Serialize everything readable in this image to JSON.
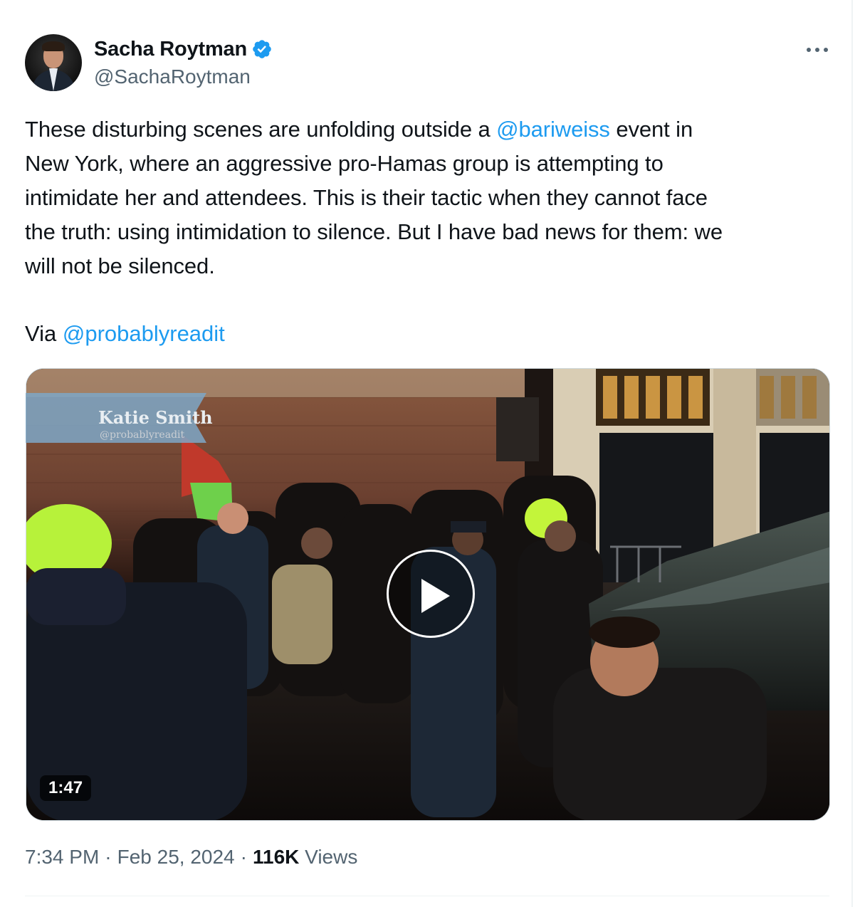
{
  "author": {
    "display_name": "Sacha Roytman",
    "handle": "@SachaRoytman",
    "verified": true,
    "verified_color": "#1d9bf0"
  },
  "menu": {
    "icon": "more-horizontal-icon",
    "glyph": "···"
  },
  "tweet": {
    "lines": [
      {
        "before": "These disturbing scenes are unfolding outside a ",
        "mention": "@bariweiss",
        "after": " event in"
      },
      {
        "text": "New York, where an aggressive pro-Hamas group is attempting to"
      },
      {
        "text": "intimidate her and attendees. This is their tactic when they cannot face"
      },
      {
        "text": "the truth: using intimidation to silence. But I have bad news for them: we"
      },
      {
        "text": "will not be silenced."
      }
    ],
    "via_label": "Via ",
    "via_mention": "@probablyreadit"
  },
  "media": {
    "type": "video",
    "duration": "1:47",
    "watermark_name": "Katie Smith",
    "watermark_handle": "@probablyreadit"
  },
  "meta": {
    "time": "7:34 PM",
    "date": "Feb 25, 2024",
    "separator": "·",
    "views_count": "116K",
    "views_label": "Views"
  },
  "colors": {
    "link": "#1d9bf0",
    "text": "#0f1419",
    "secondary": "#536471",
    "border": "#cfd9de"
  }
}
